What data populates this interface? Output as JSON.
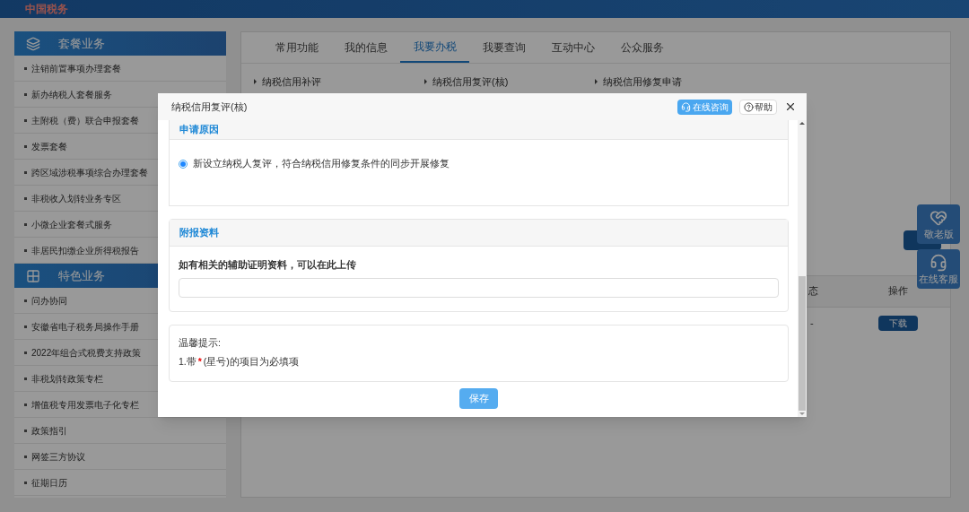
{
  "header": {
    "logo": "中国税务"
  },
  "sidebar": {
    "sections": [
      {
        "title": "套餐业务",
        "items": [
          "注销前置事项办理套餐",
          "新办纳税人套餐服务",
          "主附税（费）联合申报套餐",
          "发票套餐",
          "跨区域涉税事项综合办理套餐",
          "非税收入划转业务专区",
          "小微企业套餐式服务",
          "非居民扣缴企业所得税报告"
        ]
      },
      {
        "title": "特色业务",
        "items": [
          "问办协同",
          "安徽省电子税务局操作手册",
          "2022年组合式税费支持政策",
          "非税划转政策专栏",
          "增值税专用发票电子化专栏",
          "政策指引",
          "网签三方协议",
          "征期日历"
        ]
      }
    ]
  },
  "main": {
    "tabs": [
      {
        "label": "常用功能",
        "selected": false
      },
      {
        "label": "我的信息",
        "selected": false
      },
      {
        "label": "我要办税",
        "selected": true
      },
      {
        "label": "我要查询",
        "selected": false
      },
      {
        "label": "互动中心",
        "selected": false
      },
      {
        "label": "公众服务",
        "selected": false
      }
    ],
    "links": [
      "纳税信用补评",
      "纳税信用复评(核)",
      "纳税信用修复申请"
    ],
    "table": {
      "columns": [
        "态",
        "操作"
      ],
      "rows": [
        {
          "cells": [
            "-"
          ],
          "action": "下载"
        }
      ]
    }
  },
  "floating_buttons": [
    {
      "label": "敬老版"
    },
    {
      "label": "在线客服"
    }
  ],
  "dialog": {
    "title": "纳税信用复评(核)",
    "consult_button": "在线咨询",
    "help_button": "帮助",
    "reason": {
      "title": "申请原因",
      "options": [
        {
          "label": "新设立纳税人复评，符合纳税信用修复条件的同步开展修复",
          "selected": true
        }
      ]
    },
    "attachment": {
      "title": "附报资料",
      "label": "如有相关的辅助证明资料，可以在此上传"
    },
    "tips": {
      "title": "温馨提示:",
      "lines": [
        {
          "before": "1.带",
          "mark": "*",
          "after": "(星号)的项目为必填项"
        }
      ]
    },
    "save_button": "保存"
  }
}
